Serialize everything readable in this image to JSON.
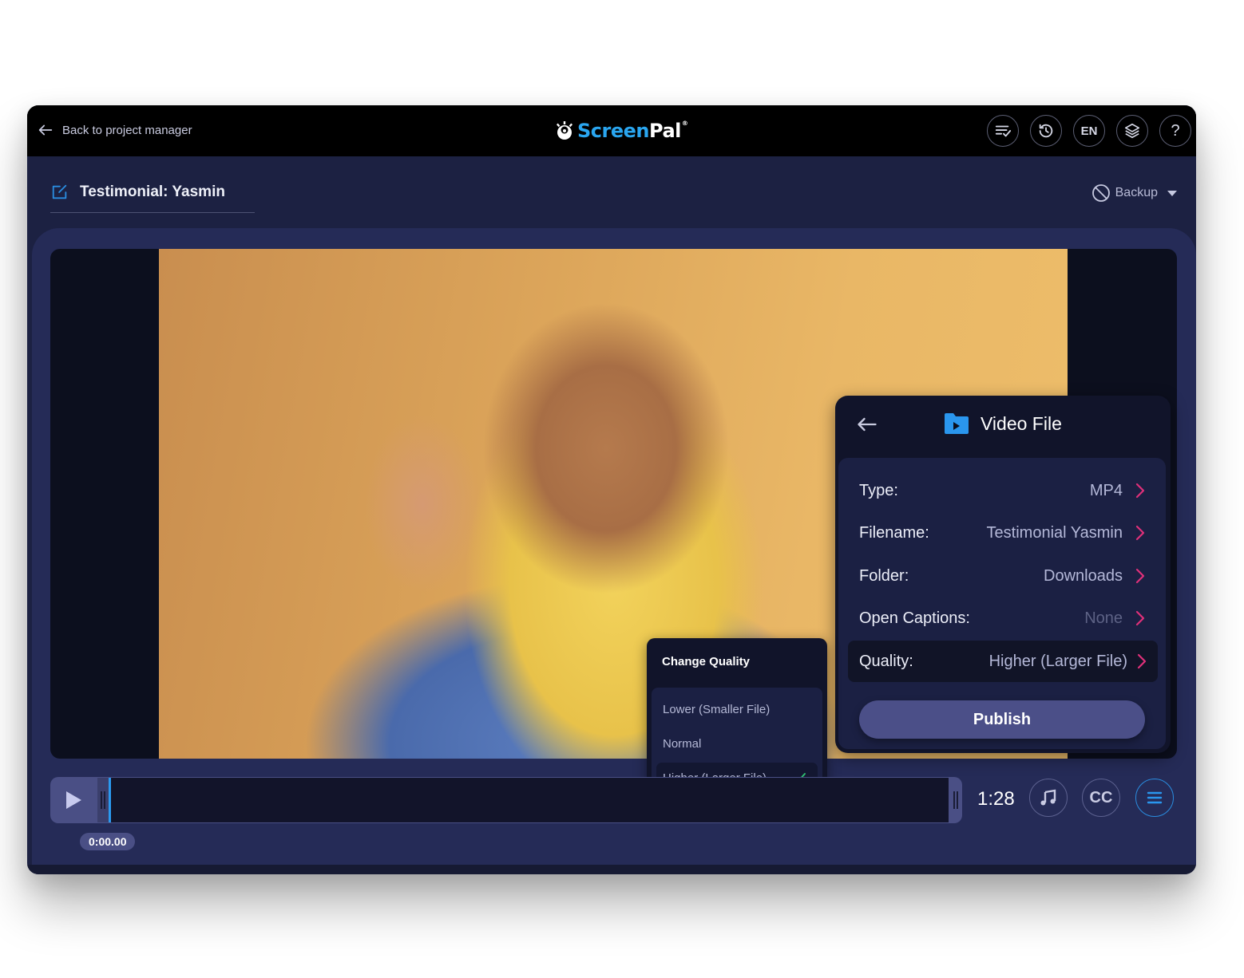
{
  "topbar": {
    "back_label": "Back to project manager",
    "logo": {
      "screen": "Screen",
      "pal": "Pal",
      "reg": "®"
    },
    "buttons": [
      {
        "name": "checklist-button",
        "icon": "checklist-icon"
      },
      {
        "name": "history-button",
        "icon": "history-icon"
      },
      {
        "name": "language-button",
        "label": "EN"
      },
      {
        "name": "layers-button",
        "icon": "layers-icon"
      },
      {
        "name": "help-button",
        "label": "?"
      }
    ]
  },
  "project": {
    "title": "Testimonial: Yasmin",
    "backup_label": "Backup"
  },
  "video_file_panel": {
    "title": "Video File",
    "rows": [
      {
        "label": "Type:",
        "value": "MP4"
      },
      {
        "label": "Filename:",
        "value": "Testimonial Yasmin"
      },
      {
        "label": "Folder:",
        "value": "Downloads"
      },
      {
        "label": "Open Captions:",
        "value": "None"
      },
      {
        "label": "Quality:",
        "value": "Higher (Larger File)"
      }
    ],
    "publish_label": "Publish"
  },
  "quality_dropdown": {
    "title": "Change Quality",
    "options": [
      {
        "label": "Lower (Smaller File)",
        "selected": false
      },
      {
        "label": "Normal",
        "selected": false
      },
      {
        "label": "Higher (Larger File)",
        "selected": true
      }
    ]
  },
  "player": {
    "current_time": "0:00.00",
    "duration": "1:28",
    "cc_label": "CC"
  },
  "colors": {
    "accent_blue": "#2aa6f0",
    "chevron_pink": "#e0307a",
    "check_green": "#2fbf71",
    "panel_bg": "#11142a",
    "app_bg": "#1c2142"
  }
}
